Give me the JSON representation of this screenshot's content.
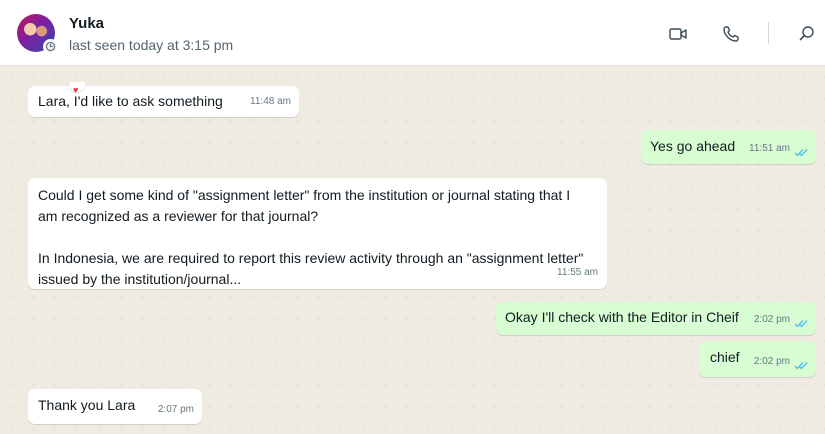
{
  "contact": {
    "name": "Yuka",
    "status": "last seen today at 3:15 pm"
  },
  "header_icons": [
    "video-call-icon",
    "voice-call-icon",
    "search-icon"
  ],
  "colors": {
    "incoming_bubble": "#ffffff",
    "outgoing_bubble": "#d9fdd3",
    "read_ticks": "#53bdeb",
    "chat_background": "#efeae2"
  },
  "messages": [
    {
      "direction": "in",
      "text": "Lara, I'd like to ask something",
      "time": "11:48 am"
    },
    {
      "direction": "out",
      "text": "Yes go ahead",
      "time": "11:51 am",
      "status": "read"
    },
    {
      "direction": "in",
      "text": "Could I get some kind of \"assignment letter\" from the institution or journal stating that I\nam recognized as a reviewer for that journal?\n\nIn Indonesia, we are required to report this review activity through an \"assignment letter\"\nissued by the institution/journal...",
      "time": "11:55 am"
    },
    {
      "direction": "out",
      "text": "Okay I'll check with the Editor in Cheif",
      "time": "2:02 pm",
      "status": "read"
    },
    {
      "direction": "out",
      "text": "chief",
      "time": "2:02 pm",
      "status": "read"
    },
    {
      "direction": "in",
      "text": "Thank you Lara",
      "time": "2:07 pm"
    }
  ]
}
